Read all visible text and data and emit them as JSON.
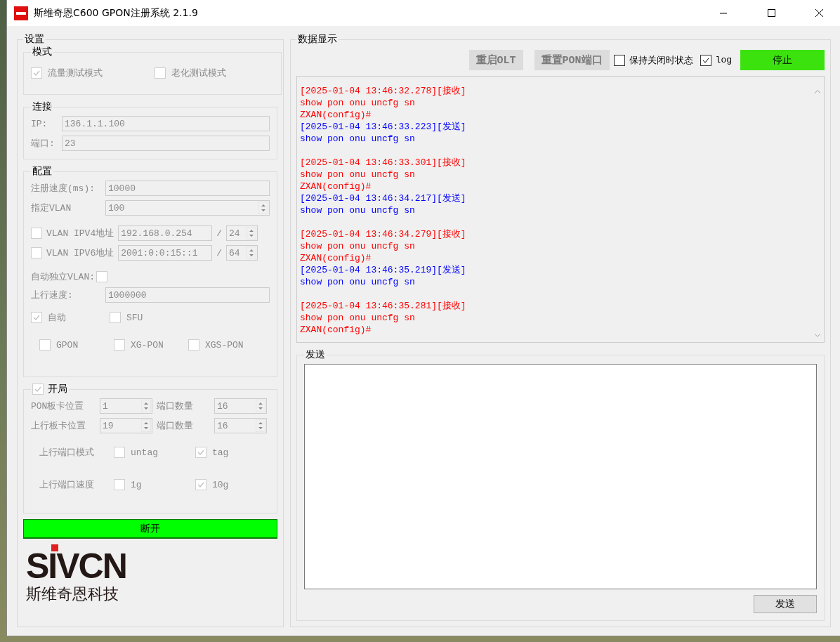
{
  "window": {
    "title": "斯维奇恩C600 GPON注册系统 2.1.9"
  },
  "settings": {
    "title": "设置",
    "disabled": true,
    "mode": {
      "title": "模式",
      "options": [
        {
          "label": "流量测试模式",
          "checked": true
        },
        {
          "label": "老化测试模式",
          "checked": false
        }
      ]
    },
    "connection": {
      "title": "连接",
      "fields": [
        {
          "label": "IP:",
          "value": "136.1.1.100"
        },
        {
          "label": "端口:",
          "value": "23"
        }
      ]
    },
    "config": {
      "title": "配置",
      "register_speed": {
        "label": "注册速度(ms):",
        "value": "10000"
      },
      "vlan": {
        "label": "指定VLAN",
        "value": "100"
      },
      "addresses": [
        {
          "label": "VLAN IPV4地址",
          "checked": false,
          "value": "192.168.0.254",
          "slash": "/",
          "prefix": "24"
        },
        {
          "label": "VLAN IPV6地址",
          "checked": false,
          "value": "2001:0:0:15::1",
          "slash": "/",
          "prefix": "64"
        }
      ],
      "auto_vlan": {
        "label": "自动独立VLAN:",
        "checked": false
      },
      "uplink_speed": {
        "label": "上行速度:",
        "value": "1000000"
      },
      "types": [
        {
          "label": "自动",
          "checked": true
        },
        {
          "label": "SFU",
          "checked": false
        }
      ],
      "pon_types": [
        {
          "label": "GPON",
          "checked": false
        },
        {
          "label": "XG-PON",
          "checked": false
        },
        {
          "label": "XGS-PON",
          "checked": false
        }
      ]
    },
    "startup": {
      "title": "开局",
      "checked": true,
      "spinners": [
        {
          "label": "PON板卡位置",
          "value": "1"
        },
        {
          "label": "端口数量",
          "value": "16"
        },
        {
          "label": "上行板卡位置",
          "value": "19"
        },
        {
          "label": "端口数量",
          "value": "16"
        }
      ],
      "option_rows": [
        {
          "label": "上行端口模式",
          "options": [
            {
              "label": "untag",
              "checked": false
            },
            {
              "label": "tag",
              "checked": true
            }
          ]
        },
        {
          "label": "上行端口速度",
          "options": [
            {
              "label": "1g",
              "checked": false
            },
            {
              "label": "10g",
              "checked": true
            }
          ]
        }
      ]
    }
  },
  "disconnect_button": "断开",
  "logo": {
    "wordmark": "SIVCN",
    "tagline": "斯维奇恩科技"
  },
  "data_display": {
    "title": "数据显示",
    "buttons": [
      {
        "label": "重启OLT",
        "disabled": true
      },
      {
        "label": "重置PON端口",
        "disabled": true
      }
    ],
    "keep_state": {
      "label": "保持关闭时状态",
      "checked": false
    },
    "log_toggle": {
      "label": "log",
      "checked": true
    },
    "stop_button": "停止",
    "log": [
      {
        "kind": "recv",
        "lines": [
          "[2025-01-04 13:46:32.278][接收]",
          "show pon onu uncfg sn",
          "ZXAN(config)#"
        ]
      },
      {
        "kind": "send",
        "lines": [
          "[2025-01-04 13:46:33.223][发送]",
          "show pon onu uncfg sn"
        ]
      },
      {
        "kind": "recv",
        "lines": [
          "[2025-01-04 13:46:33.301][接收]",
          "show pon onu uncfg sn",
          "ZXAN(config)#"
        ]
      },
      {
        "kind": "send",
        "lines": [
          "[2025-01-04 13:46:34.217][发送]",
          "show pon onu uncfg sn"
        ]
      },
      {
        "kind": "recv",
        "lines": [
          "[2025-01-04 13:46:34.279][接收]",
          "show pon onu uncfg sn",
          "ZXAN(config)#"
        ]
      },
      {
        "kind": "send",
        "lines": [
          "[2025-01-04 13:46:35.219][发送]",
          "show pon onu uncfg sn"
        ]
      },
      {
        "kind": "recv",
        "lines": [
          "[2025-01-04 13:46:35.281][接收]",
          "show pon onu uncfg sn",
          "ZXAN(config)#"
        ]
      }
    ]
  },
  "send": {
    "title": "发送",
    "button": "发送"
  }
}
